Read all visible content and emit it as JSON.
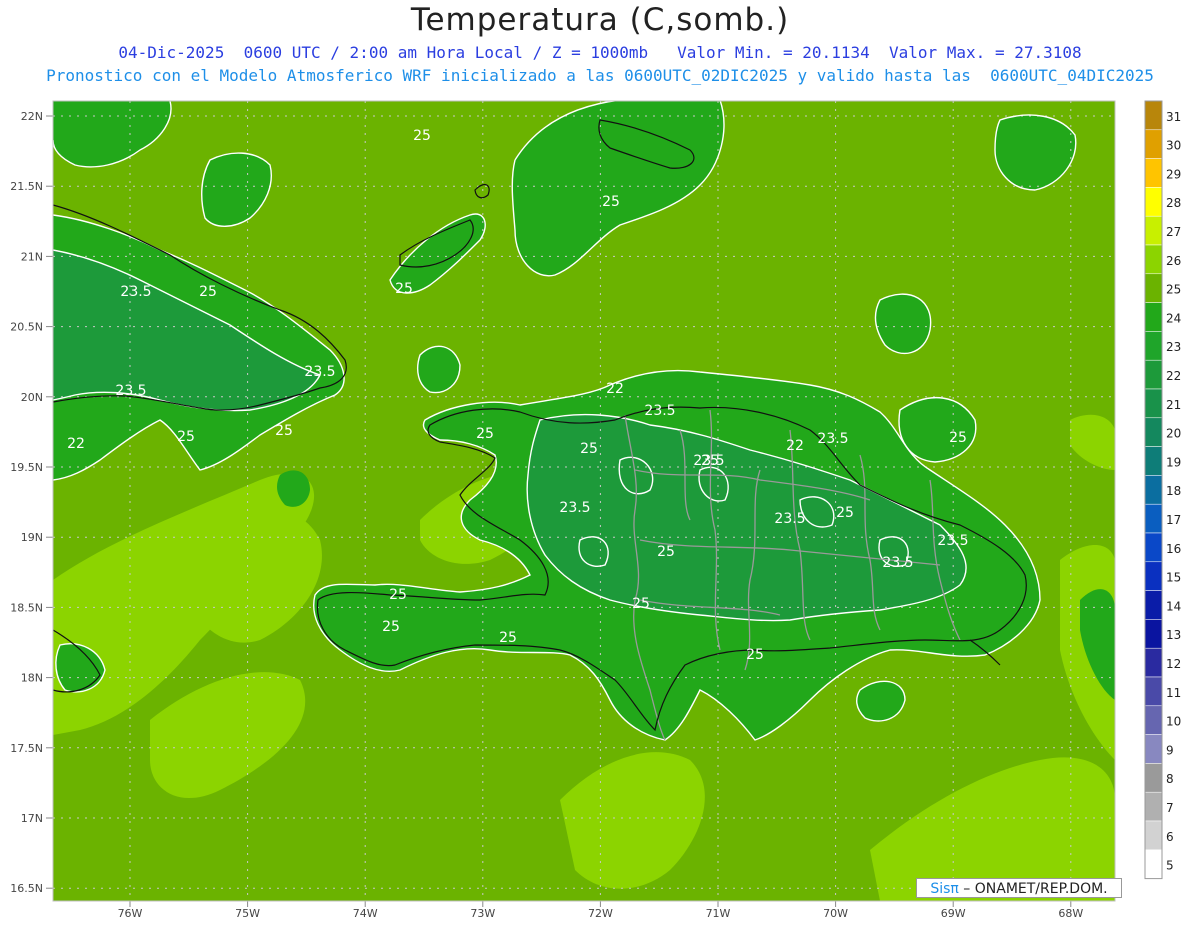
{
  "header": {
    "title": "Temperatura (C,somb.)",
    "line1": "04-Dic-2025  0600 UTC / 2:00 am Hora Local / Z = 1000mb   Valor Min. = 20.1134  Valor Max. = 27.3108",
    "line2": "Pronostico con el Modelo Atmosferico WRF inicializado a las 0600UTC_02DIC2025 y valido hasta las  0600UTC_04DIC2025"
  },
  "map": {
    "lat_ticks": [
      "22N",
      "21.5N",
      "21N",
      "20.5N",
      "20N",
      "19.5N",
      "19N",
      "18.5N",
      "18N",
      "17.5N",
      "17N",
      "16.5N"
    ],
    "lon_ticks": [
      "76W",
      "75W",
      "74W",
      "73W",
      "72W",
      "71W",
      "70W",
      "69W",
      "68W"
    ],
    "contour_labels": [
      "25",
      "25",
      "25",
      "23.5",
      "25",
      "23.5",
      "23.5",
      "22",
      "25",
      "25",
      "25",
      "25",
      "23.5",
      "23.5",
      "22",
      "23.5",
      "25",
      "25",
      "23.5",
      "22",
      "25",
      "23.5",
      "25",
      "23.5",
      "23.5",
      "25",
      "25",
      "25",
      "25",
      "25"
    ],
    "colors": {
      "sea": "#6bb300",
      "sea_warm": "#8cd400",
      "land": "#22a81a",
      "land_cool": "#1d9a3a",
      "coast": "#111111",
      "border": "#9a9a9a",
      "contour": "#ffffff"
    }
  },
  "colorbar": {
    "levels": [
      "31",
      "30",
      "29",
      "28",
      "27",
      "26",
      "25",
      "24",
      "23",
      "22",
      "21",
      "20",
      "19",
      "18",
      "17",
      "16",
      "15",
      "14",
      "13",
      "12",
      "11",
      "10",
      "9",
      "8",
      "7",
      "6",
      "5"
    ],
    "colors": [
      "#b8860b",
      "#e0a000",
      "#ffc400",
      "#ffff00",
      "#c8f000",
      "#8cd400",
      "#6bb300",
      "#22a81a",
      "#1fa52a",
      "#1d9a3a",
      "#19924a",
      "#14885e",
      "#0e7d78",
      "#0b6ea0",
      "#0a5ec0",
      "#0a48c8",
      "#0a30c0",
      "#0a1ca8",
      "#0a14a0",
      "#2a2aa0",
      "#4a4aa8",
      "#6666b0",
      "#8888c0",
      "#9a9a9a",
      "#b0b0b0",
      "#d2d2d2",
      "#ffffff"
    ]
  },
  "credit": {
    "sis": "Sisπ",
    "org": " – ONAMET/REP.DOM."
  }
}
